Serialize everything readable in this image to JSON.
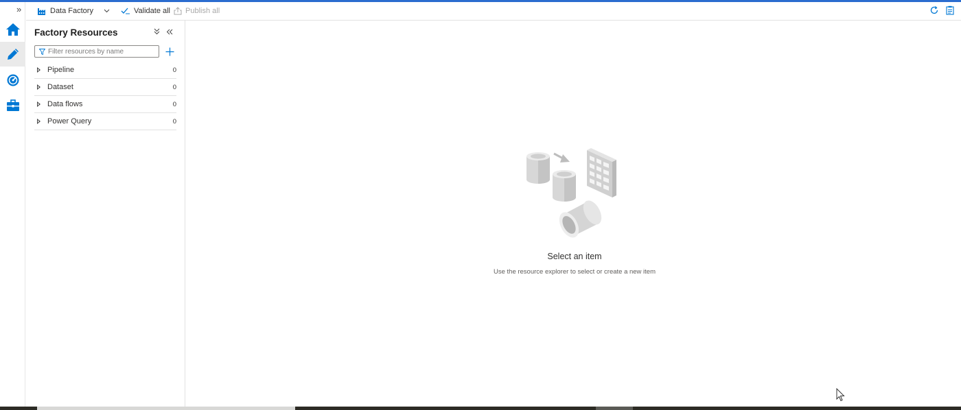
{
  "toolbar": {
    "factory_label": "Data Factory",
    "validate_label": "Validate all",
    "publish_label": "Publish all"
  },
  "panel": {
    "title": "Factory Resources",
    "filter_placeholder": "Filter resources by name",
    "filter_value": "",
    "items": [
      {
        "label": "Pipeline",
        "count": "0"
      },
      {
        "label": "Dataset",
        "count": "0"
      },
      {
        "label": "Data flows",
        "count": "0"
      },
      {
        "label": "Power Query",
        "count": "0"
      }
    ]
  },
  "rail": {
    "icons": [
      "home-icon",
      "pencil-author-icon",
      "monitor-gauge-icon",
      "toolbox-manage-icon"
    ],
    "active": "pencil-author-icon"
  },
  "empty_state": {
    "title": "Select an item",
    "subtitle": "Use the resource explorer to select or create a new item"
  },
  "colors": {
    "accent": "#0078d4",
    "top_line": "#2b6ccf"
  }
}
